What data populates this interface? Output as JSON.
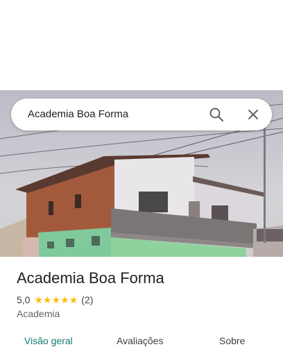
{
  "search": {
    "query": "Academia Boa Forma"
  },
  "place": {
    "name": "Academia Boa Forma",
    "rating": "5,0",
    "stars": 5,
    "review_count": "(2)",
    "category": "Academia"
  },
  "tabs": [
    {
      "label": "Visão geral",
      "active": true
    },
    {
      "label": "Avaliações",
      "active": false
    },
    {
      "label": "Sobre",
      "active": false
    }
  ],
  "colors": {
    "star": "#fbbc04",
    "active_tab": "#137a70"
  },
  "icons": {
    "search": "search-icon",
    "close": "close-icon"
  }
}
